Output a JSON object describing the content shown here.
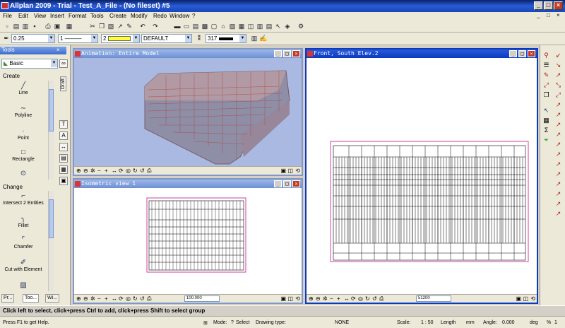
{
  "app": {
    "title": "Allplan 2009 - Trial - Test_A_File - (No fileset) #5",
    "window_buttons": [
      "_",
      "□",
      "×"
    ],
    "mdi_buttons": [
      "_",
      "□",
      "×"
    ]
  },
  "menu": [
    "File",
    "Edit",
    "View",
    "Insert",
    "Format",
    "Tools",
    "Create",
    "Modify",
    "Redo",
    "Window",
    "?"
  ],
  "format_toolbar": {
    "pen": "0.25",
    "line": "1",
    "color": "2",
    "layer": "DEFAULT",
    "pattern": "317"
  },
  "palette": {
    "title": "Tools",
    "module": "Basic",
    "side_tab": "Draft",
    "sections": [
      {
        "name": "Create",
        "items": [
          "Line",
          "Polyline",
          "Point",
          "Rectangle"
        ]
      },
      {
        "name": "Change",
        "items": [
          "Intersect 2 Entities",
          "Fillet",
          "Chamfer",
          "Cut with Element"
        ]
      }
    ],
    "tabs": [
      "Pr...",
      "Too...",
      "Wi..."
    ]
  },
  "windows": {
    "animation": {
      "title": "Animation: Entire Model"
    },
    "isometric": {
      "title": "Isometric view 1",
      "zoom": "100.000"
    },
    "front": {
      "title": "Front, South Elev.2",
      "zoom": "51200"
    }
  },
  "command_prompt": "Click left to select, click+press Ctrl to add, click+press Shift to select group",
  "status": {
    "help": "Press F1 to get Help.",
    "mode_label": "Mode:",
    "mode_value": "Select",
    "drawing_type_label": "Drawing type:",
    "drawing_type_value": "NONE",
    "scale_label": "Scale:",
    "scale_value": "1 : 50",
    "length_label": "Length",
    "length_unit": "mm",
    "angle_label": "Angle:",
    "angle_value": "0.000",
    "angle_unit": "deg",
    "percent_sign": "%",
    "percent_value": "1"
  }
}
